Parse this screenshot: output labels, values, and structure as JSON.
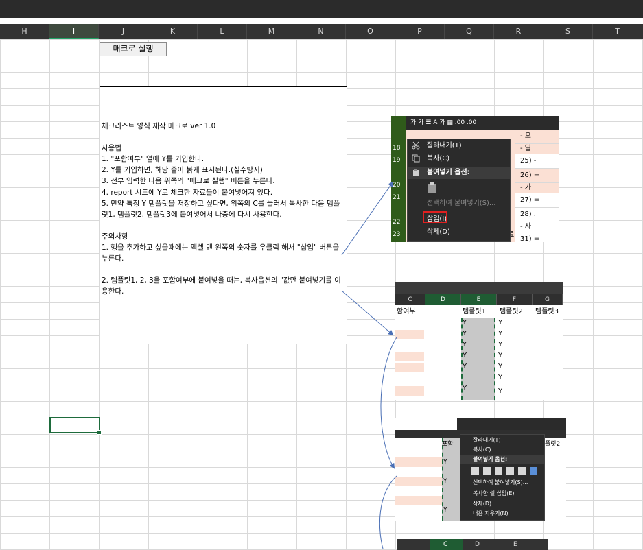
{
  "column_headers": [
    "H",
    "I",
    "J",
    "K",
    "L",
    "M",
    "N",
    "O",
    "P",
    "Q",
    "R",
    "S",
    "T"
  ],
  "selected_column": "I",
  "macro_button_label": "매크로 실행",
  "notes": {
    "title": "체크리스트 양식 제작 매크로 ver 1.0",
    "usage_heading": "사용법",
    "usage_1": "1. \"포함여부\" 열에 Y를 기입한다.",
    "usage_2": "2. Y를 기입하면, 해당 줄이 붉게 표시된다.(실수방지)",
    "usage_3": "3. 전부 입력한 다음 위쪽의 \"매크로 실행\" 버튼을 누른다.",
    "usage_4": "4. report 시트에 Y로 체크한 자료들이 붙여넣어져 있다.",
    "usage_5": "5. 만약 특정 Y 템플릿을 저장하고 싶다면, 위쪽의 C를 눌러서 복사한 다음 템플릿1, 템플릿2, 템플릿3에 붙여넣어서 나중에 다시 사용한다.",
    "caution_heading": "주의사항",
    "caution_1": "1. 행을 추가하고 싶을때에는 엑셀 맨 왼쪽의 숫자를 우클릭 해서 \"삽입\" 버튼을 누른다.",
    "caution_2": "2. 템플릿1, 2, 3을 포함여부에 붙여넣을 때는, 복사옵션의 \"값만 붙여넣기를 이용한다."
  },
  "shot1": {
    "toolbar_text": "가  가  ☰  A  가  ▦  .00  .00",
    "row_numbers": [
      "18",
      "19",
      "20",
      "21",
      "22",
      "23"
    ],
    "cells": [
      "- 오",
      "- 일",
      "25) -",
      "26) =",
      "- 가",
      "27) =",
      "28) .",
      "- 사",
      "31) ="
    ],
    "bottom_text": "료",
    "menu": {
      "cut": "잘라내기(T)",
      "copy": "복사(C)",
      "paste_options": "붙여넣기 옵션:",
      "paste_special": "선택하여 붙여넣기(S)...",
      "insert": "삽입(I)",
      "delete": "삭제(D)"
    }
  },
  "shot2": {
    "col_headers": [
      "C",
      "D",
      "E",
      "F",
      "G"
    ],
    "row_headers": [
      "함여부",
      "템플릿1",
      "템플릿2",
      "템플릿3"
    ],
    "y_values": [
      "Y",
      "Y",
      "Y",
      "Y",
      "Y",
      "Y",
      "Y",
      "Y",
      "Y",
      "Y",
      "Y",
      "Y",
      "Y"
    ]
  },
  "shot3": {
    "header_fragment": "포함",
    "header_right": "플릿2",
    "y_values": [
      "Y",
      "Y",
      "Y"
    ],
    "menu": {
      "cut": "잘라내기(T)",
      "copy": "복사(C)",
      "paste_options": "붙여넣기 옵션:",
      "paste_special": "선택하여 붙여넣기(S)...",
      "insert_copied": "복사한 셀 삽입(E)",
      "delete": "삭제(D)",
      "clear": "내용 지우기(N)"
    }
  },
  "shot4": {
    "col_headers": [
      "C",
      "D",
      "E"
    ]
  },
  "colors": {
    "accent_green": "#1e6b3c",
    "highlight_red": "#e02020",
    "pink_row": "#fbe0d4",
    "arrow_blue": "#4a6fb5"
  }
}
